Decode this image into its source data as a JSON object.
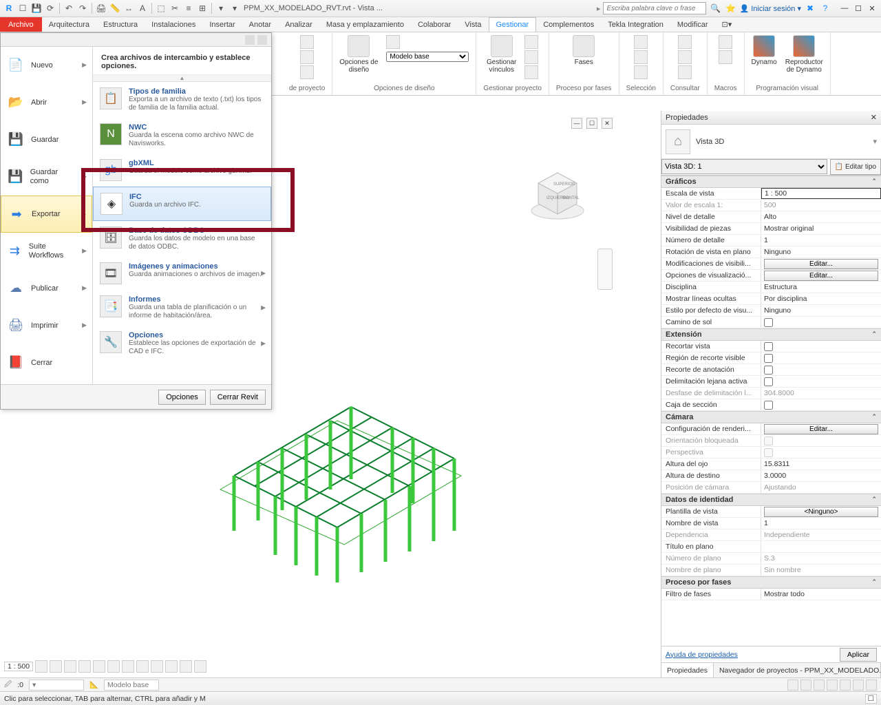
{
  "titlebar": {
    "filename": "PPM_XX_MODELADO_RVT.rvt - Vista ...",
    "search_placeholder": "Escriba palabra clave o frase",
    "signin": "Iniciar sesión"
  },
  "ribbon_tabs": {
    "file": "Archivo",
    "items": [
      "Arquitectura",
      "Estructura",
      "Instalaciones",
      "Insertar",
      "Anotar",
      "Analizar",
      "Masa y emplazamiento",
      "Colaborar",
      "Vista",
      "Gestionar",
      "Complementos",
      "Tekla Integration",
      "Modificar"
    ],
    "active": "Gestionar"
  },
  "ribbon": {
    "g1": {
      "big1": "Opciones de\ndiseño",
      "combo": "Modelo base",
      "caption": "Opciones de diseño"
    },
    "g1b": {
      "caption": "de proyecto"
    },
    "g2": {
      "big": "Gestionar\nvínculos",
      "caption": "Gestionar proyecto"
    },
    "g3": {
      "big": "Fases",
      "caption": "Proceso por fases"
    },
    "g4": {
      "caption": "Selección"
    },
    "g5": {
      "caption": "Consultar"
    },
    "g6": {
      "caption": "Macros"
    },
    "g7": {
      "big1": "Dynamo",
      "big2": "Reproductor\nde Dynamo",
      "caption": "Programación visual"
    }
  },
  "filemenu": {
    "header": "Crea archivos de intercambio y establece opciones.",
    "left": [
      {
        "label": "Nuevo"
      },
      {
        "label": "Abrir"
      },
      {
        "label": "Guardar"
      },
      {
        "label": "Guardar como"
      },
      {
        "label": "Exportar"
      },
      {
        "label": "Suite Workflows"
      },
      {
        "label": "Publicar"
      },
      {
        "label": "Imprimir"
      },
      {
        "label": "Cerrar"
      }
    ],
    "right": [
      {
        "title": "Tipos de familia",
        "desc": "Exporta a un archivo de texto (.txt) los tipos de familia de la familia actual."
      },
      {
        "title": "NWC",
        "desc": "Guarda la escena como archivo NWC de Navisworks."
      },
      {
        "title": "gbXML",
        "desc": "Guarda el modelo como archivo gbXML."
      },
      {
        "title": "IFC",
        "desc": "Guarda un archivo IFC."
      },
      {
        "title": "Base de datos ODBC",
        "desc": "Guarda los datos de modelo en una base de datos ODBC."
      },
      {
        "title": "Imágenes y animaciones",
        "desc": "Guarda animaciones o archivos de imagen."
      },
      {
        "title": "Informes",
        "desc": "Guarda una tabla de planificación o un informe de habitación/área."
      },
      {
        "title": "Opciones",
        "desc": "Establece las opciones de exportación de CAD e IFC."
      }
    ],
    "footer": {
      "options": "Opciones",
      "close": "Cerrar Revit"
    }
  },
  "properties": {
    "title": "Propiedades",
    "type_label": "Vista 3D",
    "selector": "Vista 3D: 1",
    "edit_type": "Editar tipo",
    "sections": {
      "graficos": "Gráficos",
      "extension": "Extensión",
      "camara": "Cámara",
      "identidad": "Datos de identidad",
      "fases": "Proceso por fases"
    },
    "rows": {
      "escala_vista": {
        "l": "Escala de vista",
        "v": "1 : 500"
      },
      "valor_escala": {
        "l": "Valor de escala    1:",
        "v": "500"
      },
      "nivel_detalle": {
        "l": "Nivel de detalle",
        "v": "Alto"
      },
      "visib_piezas": {
        "l": "Visibilidad de piezas",
        "v": "Mostrar original"
      },
      "num_detalle": {
        "l": "Número de detalle",
        "v": "1"
      },
      "rotacion": {
        "l": "Rotación de vista en plano",
        "v": "Ninguno"
      },
      "mod_visib": {
        "l": "Modificaciones de visibili...",
        "v": "Editar..."
      },
      "opc_visual": {
        "l": "Opciones de visualizació...",
        "v": "Editar..."
      },
      "disciplina": {
        "l": "Disciplina",
        "v": "Estructura"
      },
      "lineas_ocultas": {
        "l": "Mostrar líneas ocultas",
        "v": "Por disciplina"
      },
      "estilo_defecto": {
        "l": "Estilo por defecto de visu...",
        "v": "Ninguno"
      },
      "camino_sol": {
        "l": "Camino de sol",
        "v": ""
      },
      "recortar": {
        "l": "Recortar vista",
        "v": ""
      },
      "region_recorte": {
        "l": "Región de recorte visible",
        "v": ""
      },
      "recorte_anot": {
        "l": "Recorte de anotación",
        "v": ""
      },
      "delim_lejana": {
        "l": "Delimitación lejana activa",
        "v": ""
      },
      "desfase": {
        "l": "Desfase de delimitación l...",
        "v": "304.8000"
      },
      "caja_seccion": {
        "l": "Caja de sección",
        "v": ""
      },
      "config_render": {
        "l": "Configuración de renderi...",
        "v": "Editar..."
      },
      "orient_bloq": {
        "l": "Orientación bloqueada",
        "v": ""
      },
      "perspectiva": {
        "l": "Perspectiva",
        "v": ""
      },
      "altura_ojo": {
        "l": "Altura del ojo",
        "v": "15.8311"
      },
      "altura_dest": {
        "l": "Altura de destino",
        "v": "3.0000"
      },
      "pos_camara": {
        "l": "Posición de cámara",
        "v": "Ajustando"
      },
      "plantilla": {
        "l": "Plantilla de vista",
        "v": "<Ninguno>"
      },
      "nombre_vista": {
        "l": "Nombre de vista",
        "v": "1"
      },
      "dependencia": {
        "l": "Dependencia",
        "v": "Independiente"
      },
      "titulo_plano": {
        "l": "Título en plano",
        "v": ""
      },
      "num_plano": {
        "l": "Número de plano",
        "v": "S.3"
      },
      "nombre_plano": {
        "l": "Nombre de plano",
        "v": "Sin nombre"
      },
      "filtro_fases": {
        "l": "Filtro de fases",
        "v": "Mostrar todo"
      }
    },
    "help": "Ayuda de propiedades",
    "apply": "Aplicar",
    "tab1": "Propiedades",
    "tab2": "Navegador de proyectos - PPM_XX_MODELADO..."
  },
  "viewbar": {
    "scale": "1 : 500"
  },
  "statusbar2": {
    "combo": "Modelo base",
    "zero": ":0"
  },
  "statusbar": {
    "hint": "Clic para seleccionar, TAB para alternar, CTRL para añadir y M"
  }
}
